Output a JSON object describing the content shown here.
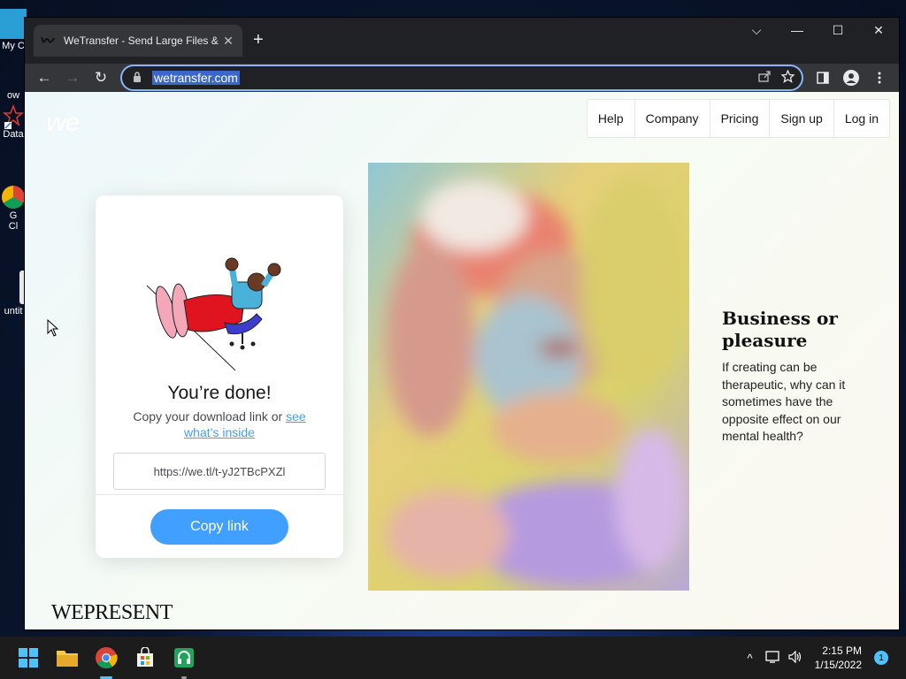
{
  "desktop": {
    "icons": [
      {
        "label": "My C"
      },
      {
        "label": "ow"
      },
      {
        "label": "Data"
      },
      {
        "label": "G"
      },
      {
        "label": "Cl"
      },
      {
        "label": "untit"
      }
    ]
  },
  "browser": {
    "tab": {
      "title": "WeTransfer - Send Large Files & S",
      "close": "✕"
    },
    "new_tab": "+",
    "window_controls": {
      "dropdown": "⌵",
      "minimize": "—",
      "maximize": "☐",
      "close": "✕"
    },
    "nav": {
      "back": "←",
      "forward": "→",
      "reload": "↻"
    },
    "address": {
      "url": "wetransfer.com"
    }
  },
  "page": {
    "logo": "we",
    "nav_items": [
      "Help",
      "Company",
      "Pricing",
      "Sign up",
      "Log in"
    ],
    "card": {
      "title": "You’re done!",
      "subtitle_prefix": "Copy your download link or ",
      "subtitle_link": "see what’s inside",
      "link_value": "https://we.tl/t-yJ2TBcPXZl",
      "copy_button": "Copy link"
    },
    "promo": {
      "title": "Business or pleasure",
      "body": "If creating can be therapeutic, why can it sometimes have the opposite effect on our mental health?"
    },
    "footer_brand": "WEPRESENT"
  },
  "taskbar": {
    "time": "2:15 PM",
    "date": "1/15/2022",
    "notification_count": "1",
    "tray_chevron": "^"
  },
  "colors": {
    "accent": "#409fff",
    "chrome_dark": "#202124",
    "chrome_toolbar": "#35363a",
    "focus_ring": "#8ab4f8"
  }
}
